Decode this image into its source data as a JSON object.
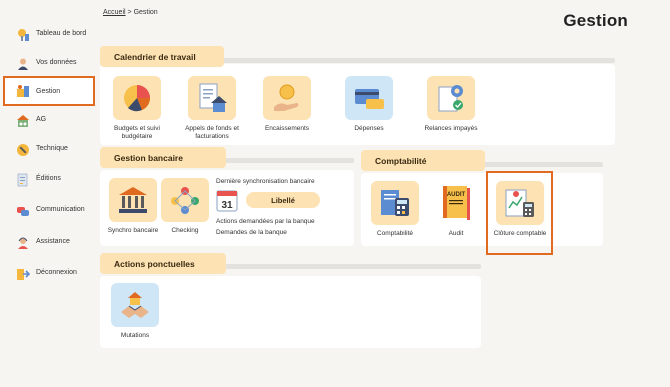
{
  "breadcrumb": {
    "home": "Accueil",
    "separator": ">",
    "current": "Gestion"
  },
  "page_title": "Gestion",
  "sidebar": {
    "items": [
      {
        "label": "Tableau de bord",
        "icon": "dashboard-icon"
      },
      {
        "label": "Vos données",
        "icon": "user-icon"
      },
      {
        "label": "Gestion",
        "icon": "management-icon",
        "active": true
      },
      {
        "label": "AG",
        "icon": "meeting-icon"
      },
      {
        "label": "Technique",
        "icon": "tools-icon"
      },
      {
        "label": "Éditions",
        "icon": "documents-icon"
      },
      {
        "label": "Communication",
        "icon": "chat-icon"
      },
      {
        "label": "Assistance",
        "icon": "support-icon"
      },
      {
        "label": "Déconnexion",
        "icon": "logout-icon"
      }
    ]
  },
  "sections": {
    "calendrier": {
      "title": "Calendrier de travail",
      "tiles": [
        {
          "label": "Budgets et suivi budgétaire",
          "icon": "pie-chart-icon"
        },
        {
          "label": "Appels de fonds et facturations",
          "icon": "invoice-house-icon"
        },
        {
          "label": "Encaissements",
          "icon": "coin-hand-icon"
        },
        {
          "label": "Dépenses",
          "icon": "card-payment-icon"
        },
        {
          "label": "Relances impayés",
          "icon": "gear-check-icon"
        }
      ]
    },
    "bancaire": {
      "title": "Gestion bancaire",
      "tiles": [
        {
          "label": "Synchro bancaire",
          "icon": "bank-icon"
        },
        {
          "label": "Checking",
          "icon": "network-icon"
        }
      ],
      "sync": {
        "title": "Dernière synchronisation bancaire",
        "calendar_day": "31",
        "button": "Libellé",
        "actions": "Actions demandées par la banque",
        "requests": "Demandes de la banque"
      }
    },
    "comptabilite": {
      "title": "Comptabilité",
      "tiles": [
        {
          "label": "Comptabilité",
          "icon": "calculator-book-icon"
        },
        {
          "label": "Audit",
          "icon": "audit-book-icon",
          "badge": "AUDIT"
        },
        {
          "label": "Clôture comptable",
          "icon": "closing-report-icon"
        }
      ]
    },
    "ponctuelles": {
      "title": "Actions ponctuelles",
      "tiles": [
        {
          "label": "Mutations",
          "icon": "handshake-house-icon"
        }
      ]
    }
  },
  "colors": {
    "accent": "#fde3b3",
    "highlight": "#e06a1f",
    "background": "#f7f5f1"
  }
}
